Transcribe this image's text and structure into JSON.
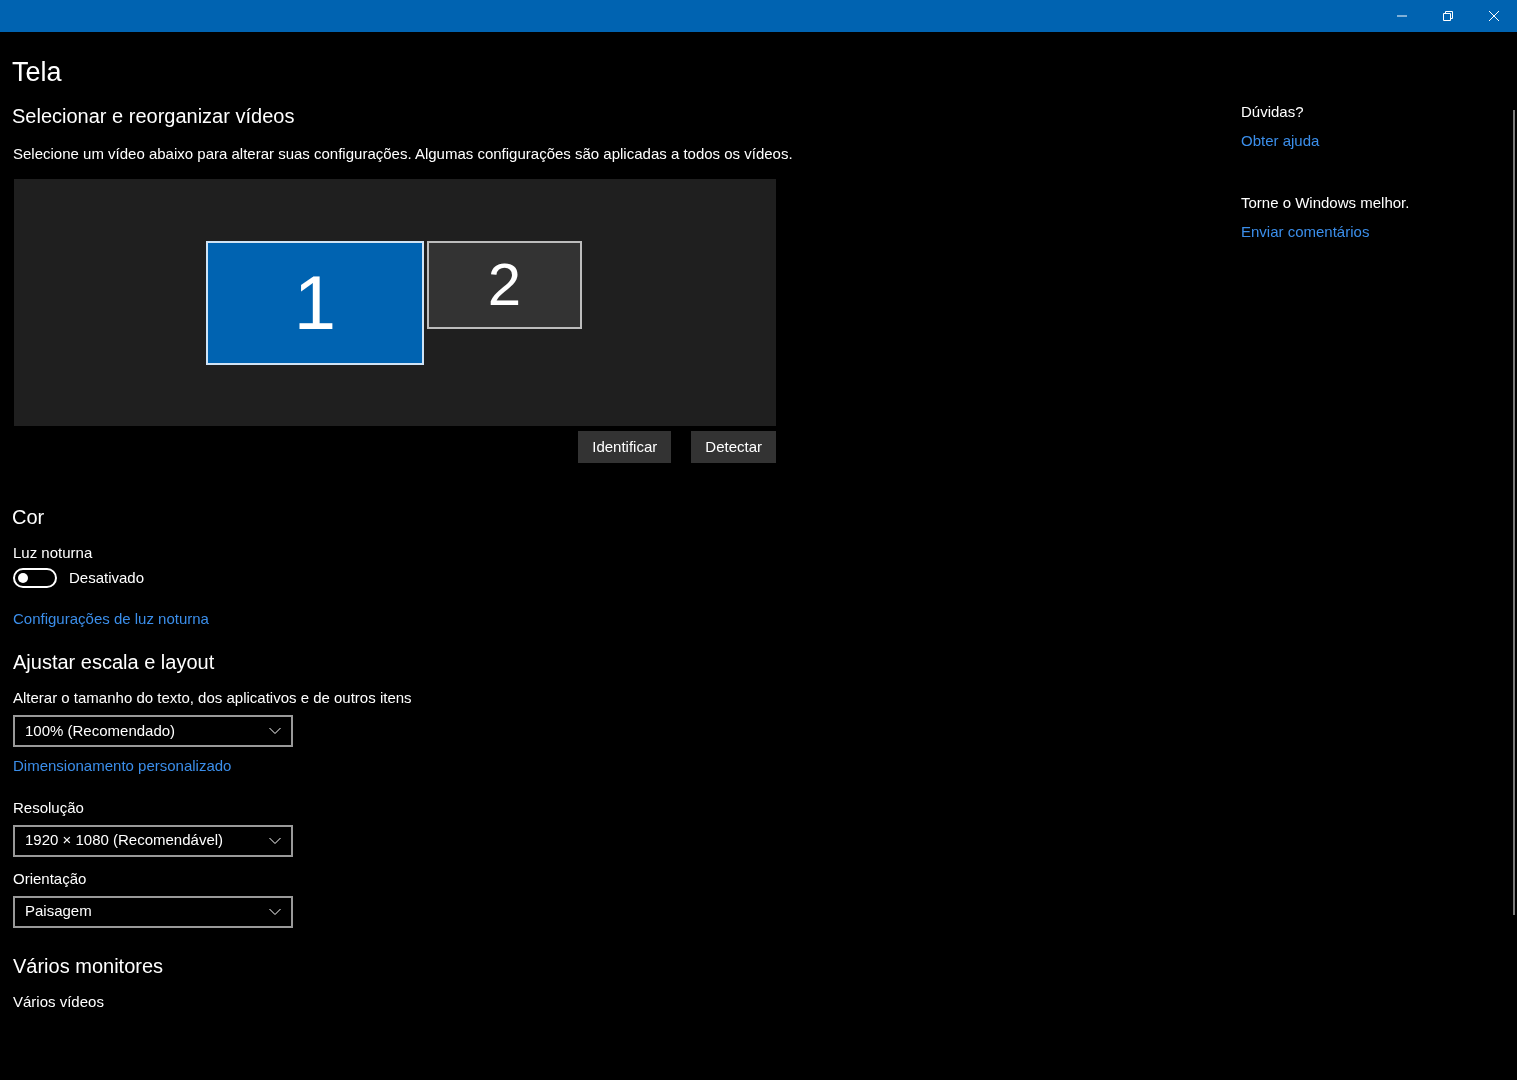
{
  "page_title": "Tela",
  "arrange": {
    "heading": "Selecionar e reorganizar vídeos",
    "description": "Selecione um vídeo abaixo para alterar suas configurações. Algumas configurações são aplicadas a todos os vídeos.",
    "monitors": [
      {
        "label": "1",
        "selected": true
      },
      {
        "label": "2",
        "selected": false
      }
    ],
    "buttons": [
      "Identificar",
      "Detectar"
    ]
  },
  "color": {
    "heading": "Cor",
    "night_light": {
      "label": "Luz noturna",
      "on": false,
      "state_text": "Desativado"
    },
    "link": "Configurações de luz noturna"
  },
  "scale": {
    "heading": "Ajustar escala e layout",
    "fields": [
      {
        "kind": "dropdown",
        "label": "Alterar o tamanho do texto, dos aplicativos e de outros itens",
        "value": "100% (Recomendado)"
      },
      {
        "kind": "link",
        "label": "Dimensionamento personalizado"
      },
      {
        "kind": "dropdown",
        "label": "Resolução",
        "value": "1920 × 1080 (Recomendável)"
      },
      {
        "kind": "dropdown",
        "label": "Orientação",
        "value": "Paisagem"
      }
    ]
  },
  "multi": {
    "heading": "Vários monitores",
    "label": "Vários vídeos"
  },
  "side": [
    {
      "text": "Dúvidas?",
      "link": "Obter ajuda"
    },
    {
      "text": "Torne o Windows melhor.",
      "link": "Enviar comentários"
    }
  ]
}
